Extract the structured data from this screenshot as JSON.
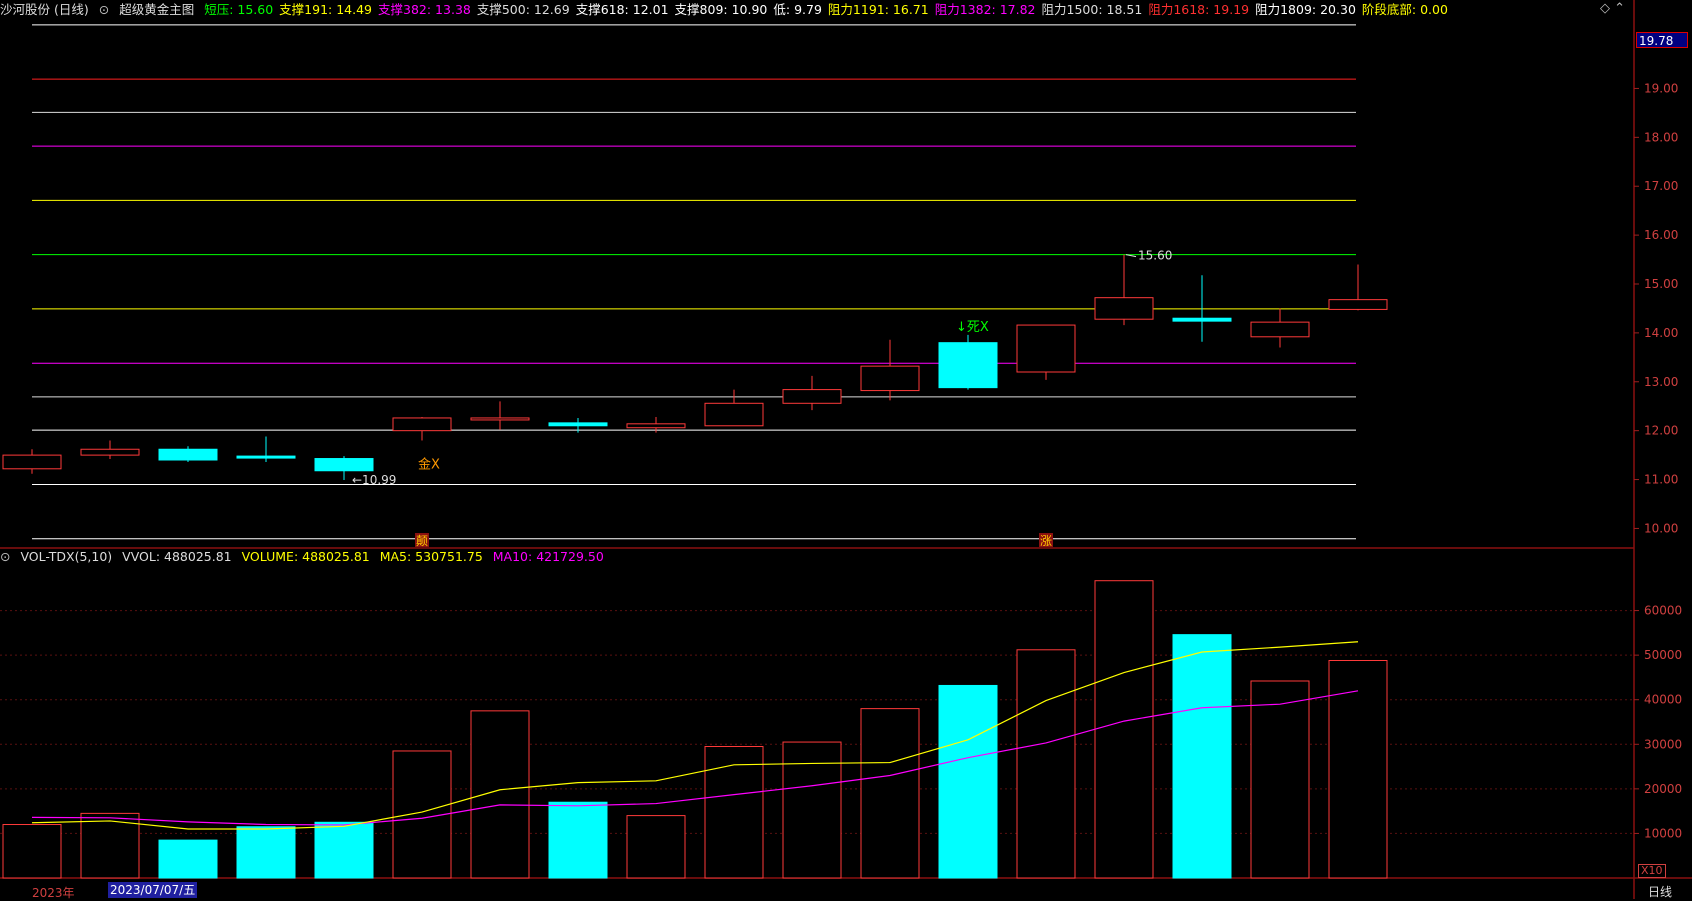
{
  "header": {
    "stock": "沙河股份 (日线)",
    "indicator": "超级黄金主图",
    "items": [
      {
        "label": "短压: 15.60",
        "color": "#00ff00"
      },
      {
        "label": "支撑191: 14.49",
        "color": "#ffff00"
      },
      {
        "label": "支撑382: 13.38",
        "color": "#ff00ff"
      },
      {
        "label": "支撑500: 12.69",
        "color": "#dddddd"
      },
      {
        "label": "支撑618: 12.01",
        "color": "#ffffff"
      },
      {
        "label": "支撑809: 10.90",
        "color": "#ffffff"
      },
      {
        "label": "低: 9.79",
        "color": "#ffffff"
      },
      {
        "label": "阻力1191: 16.71",
        "color": "#ffff00"
      },
      {
        "label": "阻力1382: 17.82",
        "color": "#ff00ff"
      },
      {
        "label": "阻力1500: 18.51",
        "color": "#dddddd"
      },
      {
        "label": "阻力1618: 19.19",
        "color": "#ff3030"
      },
      {
        "label": "阻力1809: 20.30",
        "color": "#ffffff"
      },
      {
        "label": "阶段底部: 0.00",
        "color": "#ffff00"
      }
    ],
    "window_controls": "◇ ⌃"
  },
  "volume_header": {
    "name": "VOL-TDX(5,10)",
    "vvol": "VVOL: 488025.81",
    "volume": "VOLUME: 488025.81",
    "ma5": "MA5: 530751.75",
    "ma10": "MA10: 421729.50",
    "colors": {
      "vvol": "#dddddd",
      "volume": "#ffff00",
      "ma5": "#ffff00",
      "ma10": "#ff00ff"
    }
  },
  "price_axis": {
    "current_price": "19.78",
    "ticks": [
      "19.00",
      "18.00",
      "17.00",
      "16.00",
      "15.00",
      "14.00",
      "13.00",
      "12.00",
      "11.00",
      "10.00"
    ]
  },
  "volume_axis": {
    "ticks": [
      "60000",
      "50000",
      "40000",
      "30000",
      "20000",
      "10000"
    ],
    "multiplier": "X10"
  },
  "bottom": {
    "year": "2023年",
    "date": "2023/07/07/五",
    "period": "日线"
  },
  "chart_data": {
    "type": "candlestick",
    "levels": [
      {
        "name": "阻力1809",
        "value": 20.3,
        "color": "#ffffff"
      },
      {
        "name": "阻力1618",
        "value": 19.19,
        "color": "#ff2020"
      },
      {
        "name": "阻力1500",
        "value": 18.51,
        "color": "#dddddd"
      },
      {
        "name": "阻力1382",
        "value": 17.82,
        "color": "#ff00ff"
      },
      {
        "name": "阻力1191",
        "value": 16.71,
        "color": "#ffff00"
      },
      {
        "name": "短压",
        "value": 15.6,
        "color": "#00ff00"
      },
      {
        "name": "支撑191",
        "value": 14.49,
        "color": "#ffff00"
      },
      {
        "name": "支撑382",
        "value": 13.38,
        "color": "#ff00ff"
      },
      {
        "name": "支撑500",
        "value": 12.69,
        "color": "#dddddd"
      },
      {
        "name": "支撑618",
        "value": 12.01,
        "color": "#ffffff"
      },
      {
        "name": "支撑809",
        "value": 10.9,
        "color": "#ffffff"
      },
      {
        "name": "低",
        "value": 9.79,
        "color": "#ffffff"
      }
    ],
    "candles": [
      {
        "open": 11.22,
        "close": 11.5,
        "high": 11.62,
        "low": 11.12
      },
      {
        "open": 11.5,
        "close": 11.62,
        "high": 11.8,
        "low": 11.42
      },
      {
        "open": 11.62,
        "close": 11.4,
        "high": 11.68,
        "low": 11.36
      },
      {
        "open": 11.48,
        "close": 11.46,
        "high": 11.88,
        "low": 11.36
      },
      {
        "open": 11.43,
        "close": 11.18,
        "high": 11.48,
        "low": 10.99
      },
      {
        "open": 12.0,
        "close": 12.26,
        "high": 12.28,
        "low": 11.8
      },
      {
        "open": 12.26,
        "close": 12.26,
        "high": 12.6,
        "low": 12.02
      },
      {
        "open": 12.16,
        "close": 12.1,
        "high": 12.26,
        "low": 11.96
      },
      {
        "open": 12.06,
        "close": 12.14,
        "high": 12.28,
        "low": 11.96
      },
      {
        "open": 12.1,
        "close": 12.56,
        "high": 12.84,
        "low": 12.1
      },
      {
        "open": 12.56,
        "close": 12.84,
        "high": 13.12,
        "low": 12.42
      },
      {
        "open": 12.82,
        "close": 13.32,
        "high": 13.86,
        "low": 12.62
      },
      {
        "open": 13.8,
        "close": 12.88,
        "high": 13.96,
        "low": 12.84
      },
      {
        "open": 13.2,
        "close": 14.16,
        "high": 14.16,
        "low": 13.04
      },
      {
        "open": 14.28,
        "close": 14.72,
        "high": 15.6,
        "low": 14.16
      },
      {
        "open": 14.3,
        "close": 14.24,
        "high": 15.18,
        "low": 13.82
      },
      {
        "open": 13.92,
        "close": 14.22,
        "high": 14.5,
        "low": 13.7
      },
      {
        "open": 14.48,
        "close": 14.68,
        "high": 15.4,
        "low": 14.46
      }
    ],
    "volume": [
      12000,
      14500,
      8500,
      11500,
      12500,
      28500,
      37500,
      17000,
      14000,
      29500,
      30500,
      38000,
      43200,
      51200,
      66700,
      54600,
      44200,
      48800
    ],
    "ma5": [
      12400,
      12800,
      11000,
      11000,
      11600,
      14800,
      19800,
      21400,
      21800,
      25400,
      25700,
      25900,
      31000,
      39800,
      46100,
      50700,
      51800,
      53000
    ],
    "ma10": [
      13600,
      13500,
      12600,
      12000,
      11900,
      13400,
      16400,
      16200,
      16700,
      18700,
      20700,
      23000,
      27000,
      30300,
      35200,
      38200,
      39000,
      42000
    ],
    "annotations": [
      {
        "text": "←10.99",
        "candle": 4,
        "price": 10.99,
        "color": "#dddddd"
      },
      {
        "text": "金X",
        "candle": 5,
        "price": 11.43,
        "color": "#ff9900"
      },
      {
        "text": "↓死X",
        "candle": 12,
        "price": 14.0,
        "color": "#00ff00"
      },
      {
        "text": "15.60",
        "candle": 14,
        "price": 15.6,
        "color": "#dddddd"
      }
    ],
    "markers": [
      {
        "text": "颠",
        "candle": 5
      },
      {
        "text": "涨",
        "candle": 13
      }
    ],
    "price_range": [
      9.6,
      20.4
    ],
    "volume_range": [
      0,
      70000
    ]
  }
}
